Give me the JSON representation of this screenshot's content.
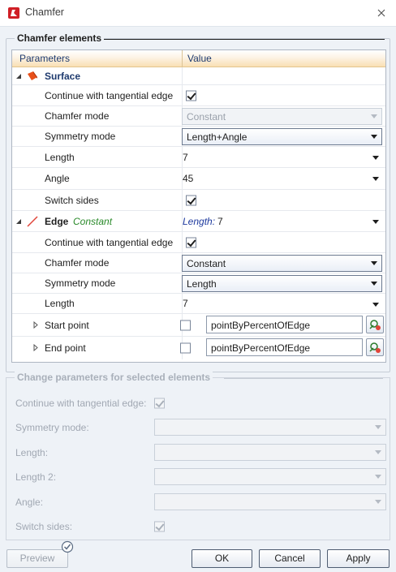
{
  "window": {
    "title": "Chamfer"
  },
  "chamfer_elements": {
    "title": "Chamfer elements",
    "columns": {
      "parameters": "Parameters",
      "value": "Value"
    },
    "surface": {
      "label": "Surface",
      "continue_label": "Continue with tangential edge",
      "continue_checked": true,
      "chamfer_mode_label": "Chamfer mode",
      "chamfer_mode_value": "Constant",
      "symmetry_mode_label": "Symmetry mode",
      "symmetry_mode_value": "Length+Angle",
      "length_label": "Length",
      "length_value": "7",
      "angle_label": "Angle",
      "angle_value": "45",
      "switch_sides_label": "Switch sides",
      "switch_sides_checked": true
    },
    "edge": {
      "label": "Edge",
      "mode_tag": "Constant",
      "summary_label": "Length:",
      "summary_value": "7",
      "continue_label": "Continue with tangential edge",
      "continue_checked": true,
      "chamfer_mode_label": "Chamfer mode",
      "chamfer_mode_value": "Constant",
      "symmetry_mode_label": "Symmetry mode",
      "symmetry_mode_value": "Length",
      "length_label": "Length",
      "length_value": "7",
      "start_point_label": "Start point",
      "start_point_value": "pointByPercentOfEdge",
      "end_point_label": "End point",
      "end_point_value": "pointByPercentOfEdge"
    }
  },
  "change_params": {
    "title": "Change parameters for selected elements",
    "continue_label": "Continue with tangential edge:",
    "symmetry_label": "Symmetry mode:",
    "length_label": "Length:",
    "length2_label": "Length 2:",
    "angle_label": "Angle:",
    "switch_label": "Switch sides:"
  },
  "buttons": {
    "preview": "Preview",
    "ok": "OK",
    "cancel": "Cancel",
    "apply": "Apply"
  },
  "colors": {
    "header_gradient": "#f9dfb4",
    "accent_text": "#1e3a6e",
    "constant_green": "#2a8a2a",
    "surface_orange": "#e8501a"
  }
}
